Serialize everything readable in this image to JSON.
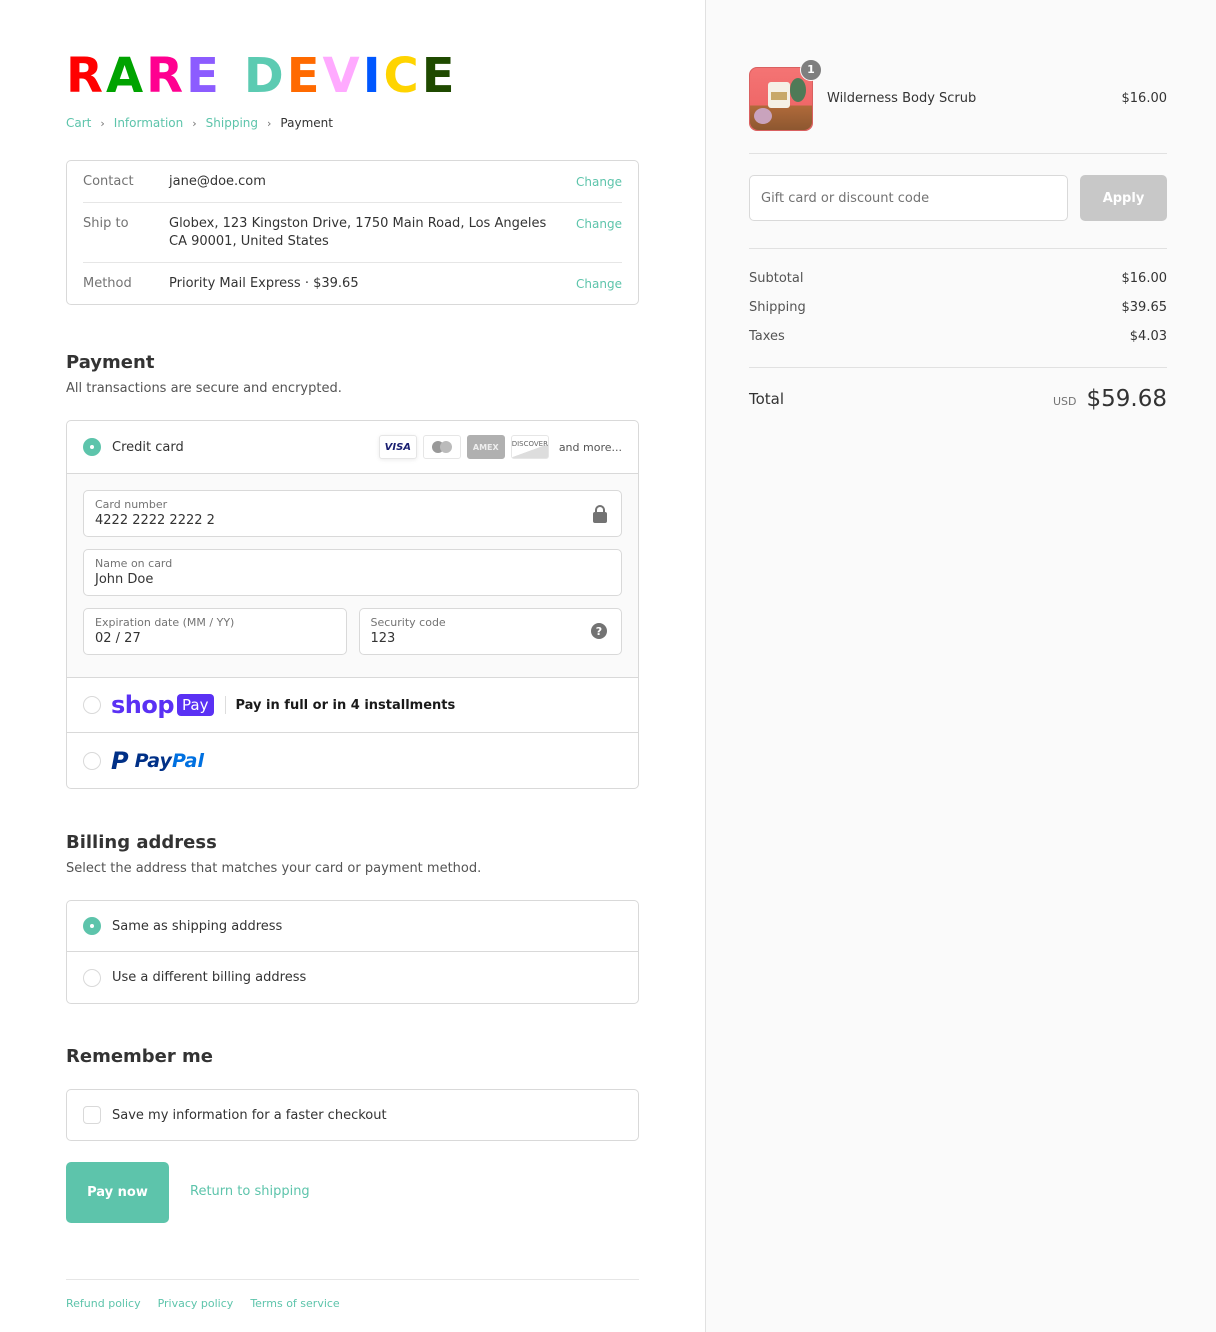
{
  "brand": {
    "logo_letters": [
      {
        "ch": "R",
        "color": "#ff0000"
      },
      {
        "ch": "A",
        "color": "#00a300"
      },
      {
        "ch": "R",
        "color": "#ff0090"
      },
      {
        "ch": "E",
        "color": "#8c5cff"
      },
      {
        "ch": " ",
        "color": "#ffffff"
      },
      {
        "ch": "D",
        "color": "#5ccbb2"
      },
      {
        "ch": "E",
        "color": "#ff6a00"
      },
      {
        "ch": "V",
        "color": "#ffaaff"
      },
      {
        "ch": "I",
        "color": "#0057ff"
      },
      {
        "ch": "C",
        "color": "#ffd400"
      },
      {
        "ch": "E",
        "color": "#1f4a00"
      }
    ],
    "accent": "#5dc4ab"
  },
  "breadcrumb": {
    "items": [
      "Cart",
      "Information",
      "Shipping"
    ],
    "current": "Payment",
    "separator": "›"
  },
  "review": {
    "rows": [
      {
        "label": "Contact",
        "value": "jane@doe.com",
        "action": "Change"
      },
      {
        "label": "Ship to",
        "value": "Globex, 123 Kingston Drive, 1750 Main Road, Los Angeles CA 90001, United States",
        "action": "Change"
      },
      {
        "label": "Method",
        "value": "Priority Mail Express · ",
        "value_bold": "$39.65",
        "action": "Change"
      }
    ]
  },
  "payment": {
    "title": "Payment",
    "subtitle": "All transactions are secure and encrypted.",
    "credit_card": {
      "label": "Credit card",
      "selected": true,
      "brands": [
        "VISA",
        "Mastercard",
        "AMEX",
        "DISCOVER"
      ],
      "more": "and more...",
      "fields": {
        "card_number": {
          "label": "Card number",
          "value": "4222 2222 2222 2"
        },
        "name": {
          "label": "Name on card",
          "value": "John Doe"
        },
        "expiry": {
          "label": "Expiration date (MM / YY)",
          "value": "02 / 27"
        },
        "cvv": {
          "label": "Security code",
          "value": "123"
        }
      }
    },
    "shop_pay": {
      "word": "shop",
      "pay": "Pay",
      "text": "Pay in full or in 4 installments",
      "selected": false
    },
    "paypal": {
      "p": "P",
      "word_a": "Pay",
      "word_b": "Pal",
      "selected": false
    }
  },
  "billing": {
    "title": "Billing address",
    "subtitle": "Select the address that matches your card or payment method.",
    "options": [
      {
        "label": "Same as shipping address",
        "selected": true
      },
      {
        "label": "Use a different billing address",
        "selected": false
      }
    ]
  },
  "remember": {
    "title": "Remember me",
    "checkbox_label": "Save my information for a faster checkout",
    "checked": false
  },
  "actions": {
    "pay_now": "Pay now",
    "return": "Return to shipping"
  },
  "footer": {
    "links": [
      "Refund policy",
      "Privacy policy",
      "Terms of service"
    ]
  },
  "summary": {
    "product": {
      "name": "Wilderness Body Scrub",
      "price": "$16.00",
      "quantity": "1"
    },
    "discount": {
      "placeholder": "Gift card or discount code",
      "value": "",
      "apply": "Apply"
    },
    "lines": [
      {
        "label": "Subtotal",
        "value": "$16.00"
      },
      {
        "label": "Shipping",
        "value": "$39.65"
      },
      {
        "label": "Taxes",
        "value": "$4.03"
      }
    ],
    "total": {
      "label": "Total",
      "currency": "USD",
      "value": "$59.68"
    }
  }
}
